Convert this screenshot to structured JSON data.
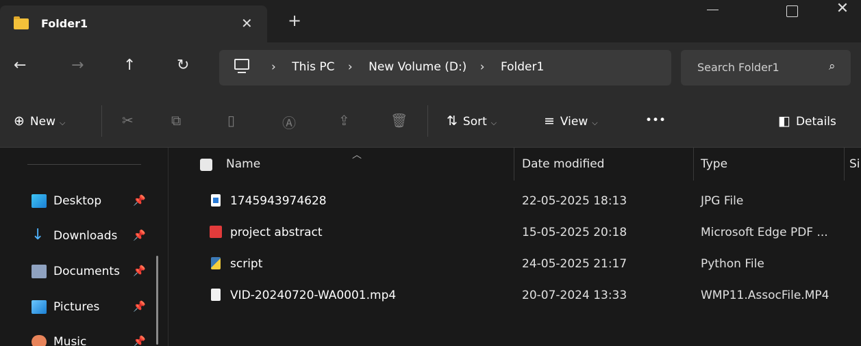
{
  "window": {
    "tab_title": "Folder1",
    "tab_close": "✕",
    "new_tab": "+",
    "close": "✕"
  },
  "nav": {
    "back": "←",
    "forward": "→",
    "up": "↑",
    "refresh": "↻"
  },
  "address": {
    "breadcrumbs": [
      "This PC",
      "New Volume (D:)",
      "Folder1"
    ],
    "separator": "›"
  },
  "search": {
    "placeholder": "Search Folder1",
    "icon": "⌕"
  },
  "toolbar": {
    "new_label": "New",
    "sort_label": "Sort",
    "view_label": "View",
    "more_label": "•••",
    "details_label": "Details"
  },
  "sidebar": {
    "items": [
      {
        "label": "Desktop",
        "icon": "desktop-icon"
      },
      {
        "label": "Downloads",
        "icon": "downloads-icon"
      },
      {
        "label": "Documents",
        "icon": "documents-icon"
      },
      {
        "label": "Pictures",
        "icon": "pictures-icon"
      },
      {
        "label": "Music",
        "icon": "music-icon"
      }
    ]
  },
  "columns": {
    "name": "Name",
    "date": "Date modified",
    "type": "Type",
    "size": "Si"
  },
  "files": [
    {
      "name": "1745943974628",
      "date": "22-05-2025 18:13",
      "type": "JPG File",
      "icon": "jpg-file-icon"
    },
    {
      "name": "project abstract",
      "date": "15-05-2025 20:18",
      "type": "Microsoft Edge PDF ...",
      "icon": "pdf-file-icon"
    },
    {
      "name": "script",
      "date": "24-05-2025 21:17",
      "type": "Python File",
      "icon": "python-file-icon"
    },
    {
      "name": "VID-20240720-WA0001.mp4",
      "date": "20-07-2024 13:33",
      "type": "WMP11.AssocFile.MP4",
      "icon": "mp4-file-icon"
    }
  ]
}
